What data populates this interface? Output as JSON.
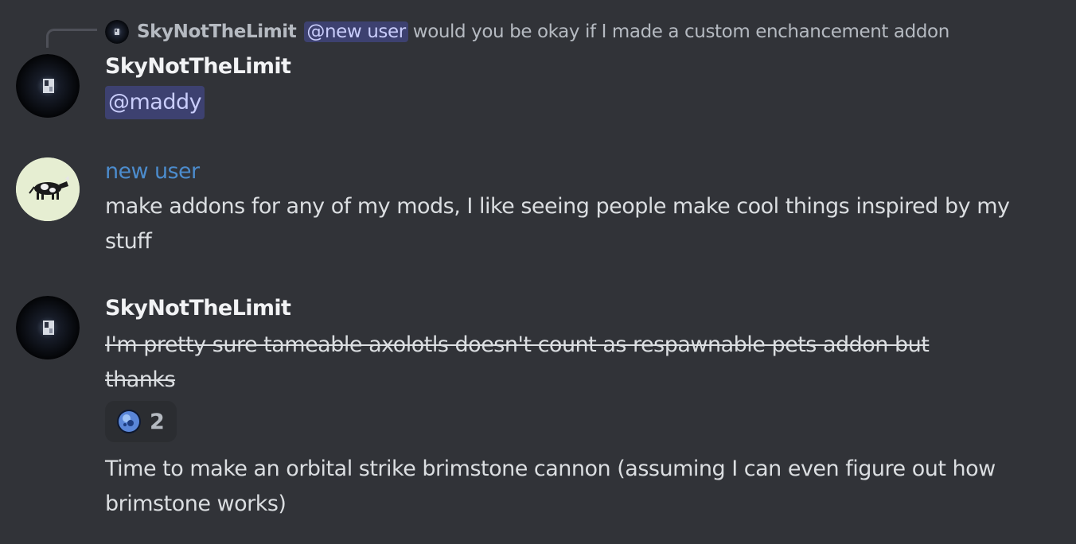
{
  "reply": {
    "author": "SkyNotTheLimit",
    "mention": "@new user",
    "text": "would you be okay if I made a custom enchancement addon"
  },
  "messages": [
    {
      "author": "SkyNotTheLimit",
      "mention": "@maddy"
    },
    {
      "author": "new user",
      "author_color": "#4c8ccd",
      "text": "make addons for any of my mods, I like seeing people make cool things inspired by my stuff"
    },
    {
      "author": "SkyNotTheLimit",
      "text_strikethrough": "I'm pretty sure tameable axolotls doesn't count as respawnable pets addon but thanks",
      "reaction": {
        "icon": "orb-emoji",
        "count": "2"
      },
      "followup_text": "Time to make an orbital strike brimstone cannon (assuming I can even figure out how brimstone works)"
    }
  ],
  "colors": {
    "background": "#313338",
    "text": "#dbdee1",
    "muted": "#b5bac1",
    "mention_bg": "rgba(88,101,242,0.3)",
    "mention_text": "#c9cdfb"
  }
}
